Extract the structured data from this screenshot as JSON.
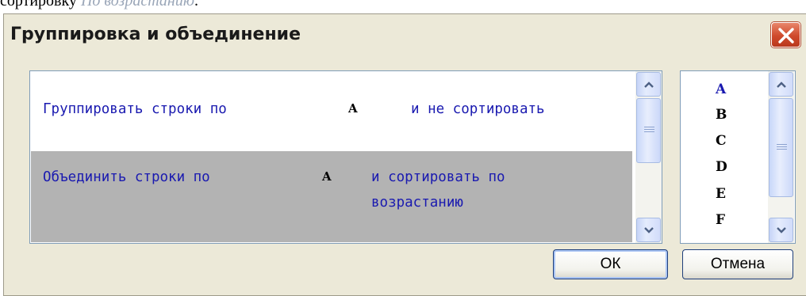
{
  "caption": {
    "text": "сортировку",
    "italic_text": "По возрастанию",
    "suffix": "."
  },
  "dialog": {
    "title": "Группировка и объединение",
    "close_icon": "close-x-icon"
  },
  "options": [
    {
      "prefix": "Группировать строки по",
      "letter": "A",
      "suffix": "и не сортировать",
      "selected": false
    },
    {
      "prefix": "Объединить строки по",
      "letter": "A",
      "suffix_line1": "и сортировать по",
      "suffix_line2": "возрастанию",
      "selected": true
    }
  ],
  "columns": {
    "items": [
      "A",
      "B",
      "C",
      "D",
      "E",
      "F"
    ],
    "selected": "A"
  },
  "buttons": {
    "ok": "ОК",
    "cancel": "Отмена"
  },
  "colors": {
    "dialog_bg": "#ece9d8",
    "option_text": "#1a1ab0",
    "selected_row": "#b3b3b3",
    "close": "#cf4a2c"
  }
}
